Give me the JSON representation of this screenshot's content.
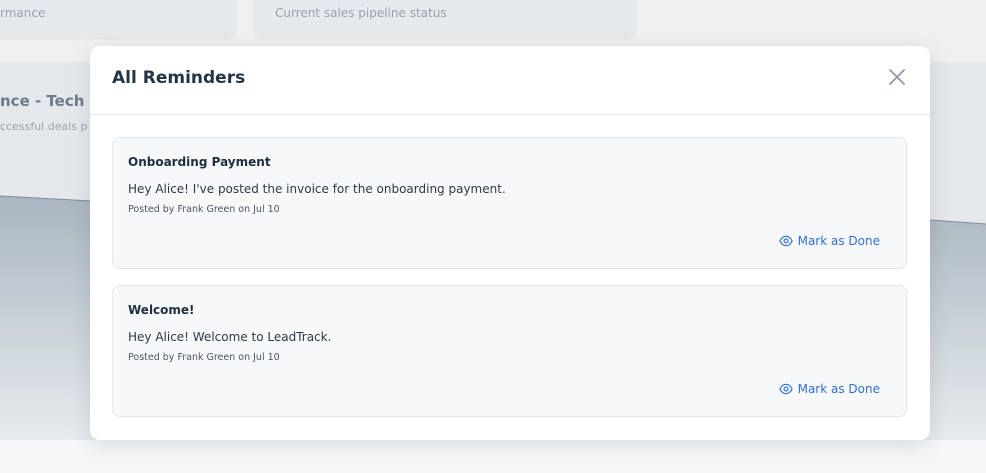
{
  "background": {
    "card_left_subtitle": "rmance",
    "card_right_subtitle": "Current sales pipeline status",
    "panel_title": "nce - Tech So",
    "panel_desc": "ccessful deals p"
  },
  "modal": {
    "title": "All Reminders",
    "close_icon": "close-icon",
    "reminders": [
      {
        "title": "Onboarding Payment",
        "message": "Hey Alice! I've posted the invoice for the onboarding payment.",
        "meta": "Posted by Frank Green on Jul 10",
        "action_label": "Mark as Done",
        "action_icon": "eye-icon"
      },
      {
        "title": "Welcome!",
        "message": "Hey Alice! Welcome to LeadTrack.",
        "meta": "Posted by Frank Green on Jul 10",
        "action_label": "Mark as Done",
        "action_icon": "eye-icon"
      }
    ]
  },
  "colors": {
    "accent": "#2f6fd6",
    "title": "#243447",
    "backdrop": "#e4e8eb"
  }
}
